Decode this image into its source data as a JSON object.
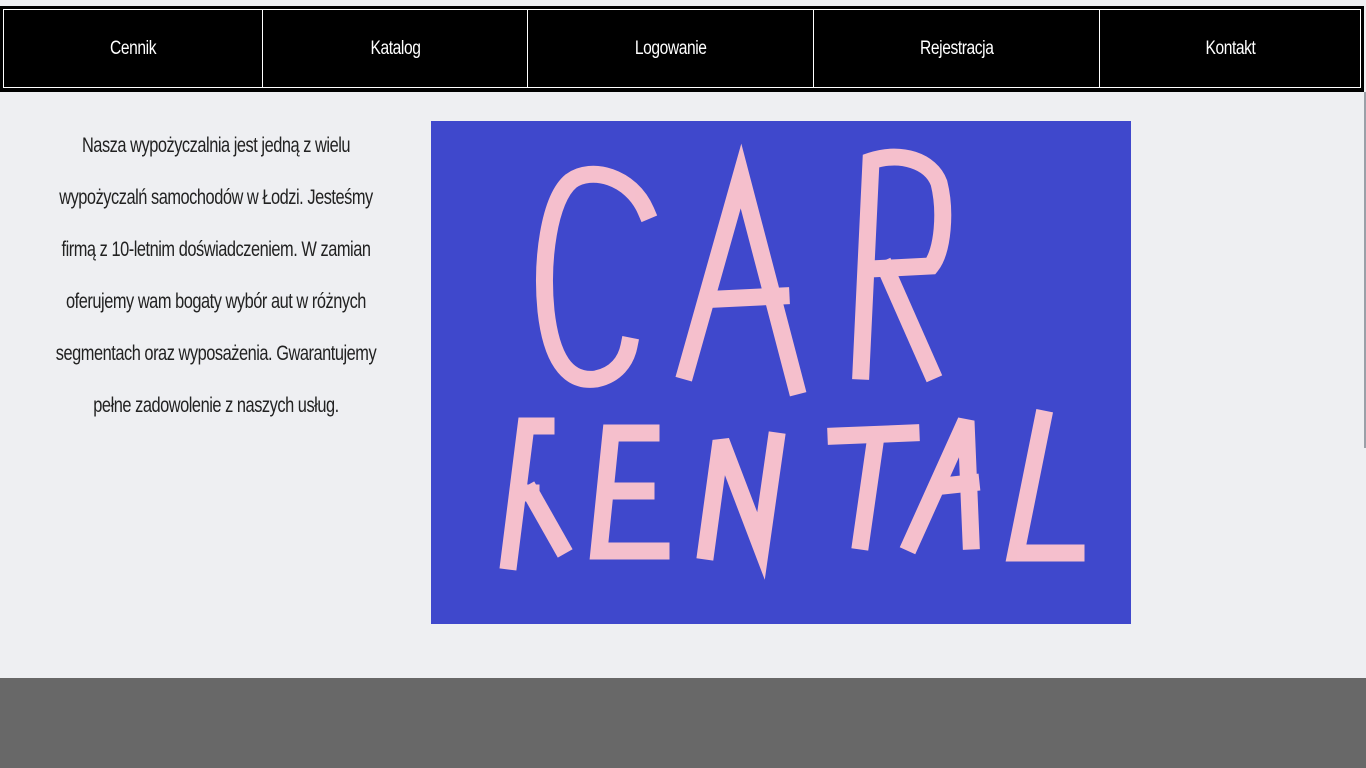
{
  "nav": {
    "items": [
      {
        "label": "Cennik"
      },
      {
        "label": "Katalog"
      },
      {
        "label": "Logowanie"
      },
      {
        "label": "Rejestracja"
      },
      {
        "label": "Kontakt"
      }
    ]
  },
  "intro": {
    "text": "Nasza wypożyczalnia jest jedną z wielu wypożyczalń samochodów w Łodzi. Jesteśmy firmą z 10-letnim doświadczeniem. W zamian oferujemy wam bogaty wybór aut w różnych segmentach oraz wyposażenia. Gwarantujemy pełne zadowolenie z naszych usług."
  },
  "banner": {
    "line1": "CAR",
    "line2": "RENTAL",
    "background_color": "#3f48cc",
    "letter_color": "#ffc6cc"
  },
  "colors": {
    "nav_background": "#000000",
    "page_background": "#eeeff2",
    "footer_background": "#686868"
  }
}
